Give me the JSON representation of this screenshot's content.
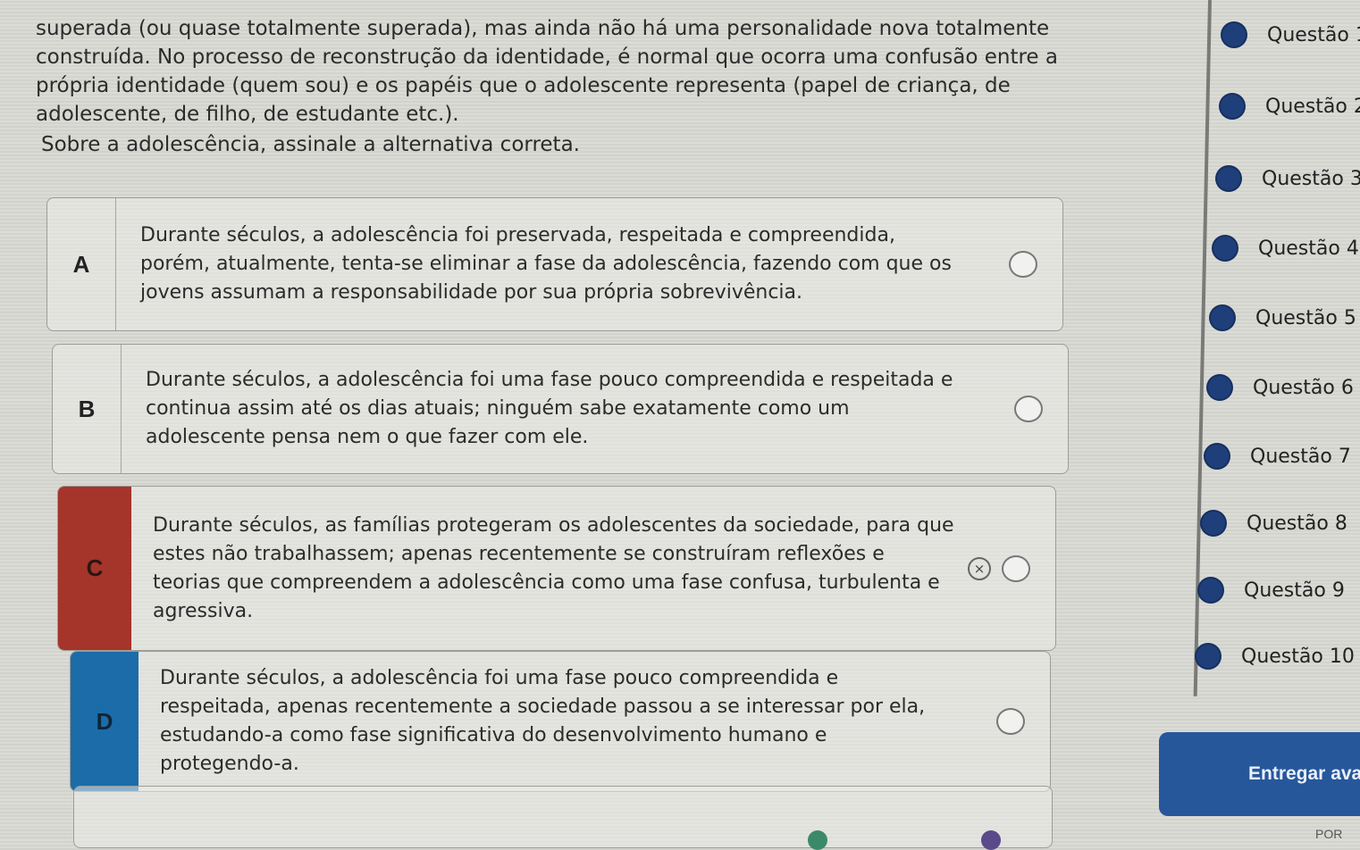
{
  "passage": {
    "line1": "superada (ou quase totalmente superada), mas ainda não há uma personalidade nova totalmente",
    "line2": "construída. No processo de reconstrução da identidade, é normal que ocorra uma confusão entre a",
    "line3": "própria identidade (quem sou) e os papéis que o adolescente representa (papel de criança, de",
    "line4": "adolescente, de filho, de estudante etc.)."
  },
  "question": "Sobre a adolescência, assinale a alternativa correta.",
  "options": [
    {
      "letter": "A",
      "text": "Durante séculos, a adolescência foi preservada, respeitada e compreendida, porém, atualmente, tenta-se eliminar a fase da adolescência, fazendo com que os jovens assumam a responsabilidade por sua própria sobrevivência."
    },
    {
      "letter": "B",
      "text": "Durante séculos, a adolescência foi uma fase pouco compreendida e respeitada e continua assim até os dias atuais; ninguém sabe exatamente como um adolescente pensa nem o que fazer com ele."
    },
    {
      "letter": "C",
      "text": "Durante séculos, as famílias protegeram os adolescentes da sociedade, para que estes não trabalhassem; apenas recentemente se construíram reflexões e teorias que compreendem a adolescência como uma fase confusa, turbulenta e agressiva."
    },
    {
      "letter": "D",
      "text": "Durante séculos, a adolescência foi uma fase pouco compreendida e respeitada, apenas recentemente a sociedade passou a se interessar por ela, estudando-a como fase significativa do desenvolvimento humano e protegendo-a."
    }
  ],
  "eliminate_icon": "×",
  "question_nav": [
    {
      "label": "Questão 1"
    },
    {
      "label": "Questão 2"
    },
    {
      "label": "Questão 3"
    },
    {
      "label": "Questão 4"
    },
    {
      "label": "Questão 5"
    },
    {
      "label": "Questão 6"
    },
    {
      "label": "Questão 7"
    },
    {
      "label": "Questão 8"
    },
    {
      "label": "Questão 9"
    },
    {
      "label": "Questão 10"
    }
  ],
  "submit_label": "Entregar avaliação",
  "footer_text": "POR",
  "colors": {
    "option_c_selected": "#a5342a",
    "option_d_highlight": "#1b6ca8",
    "nav_dot": "#1f3f7a",
    "submit_bg": "#27579b"
  }
}
